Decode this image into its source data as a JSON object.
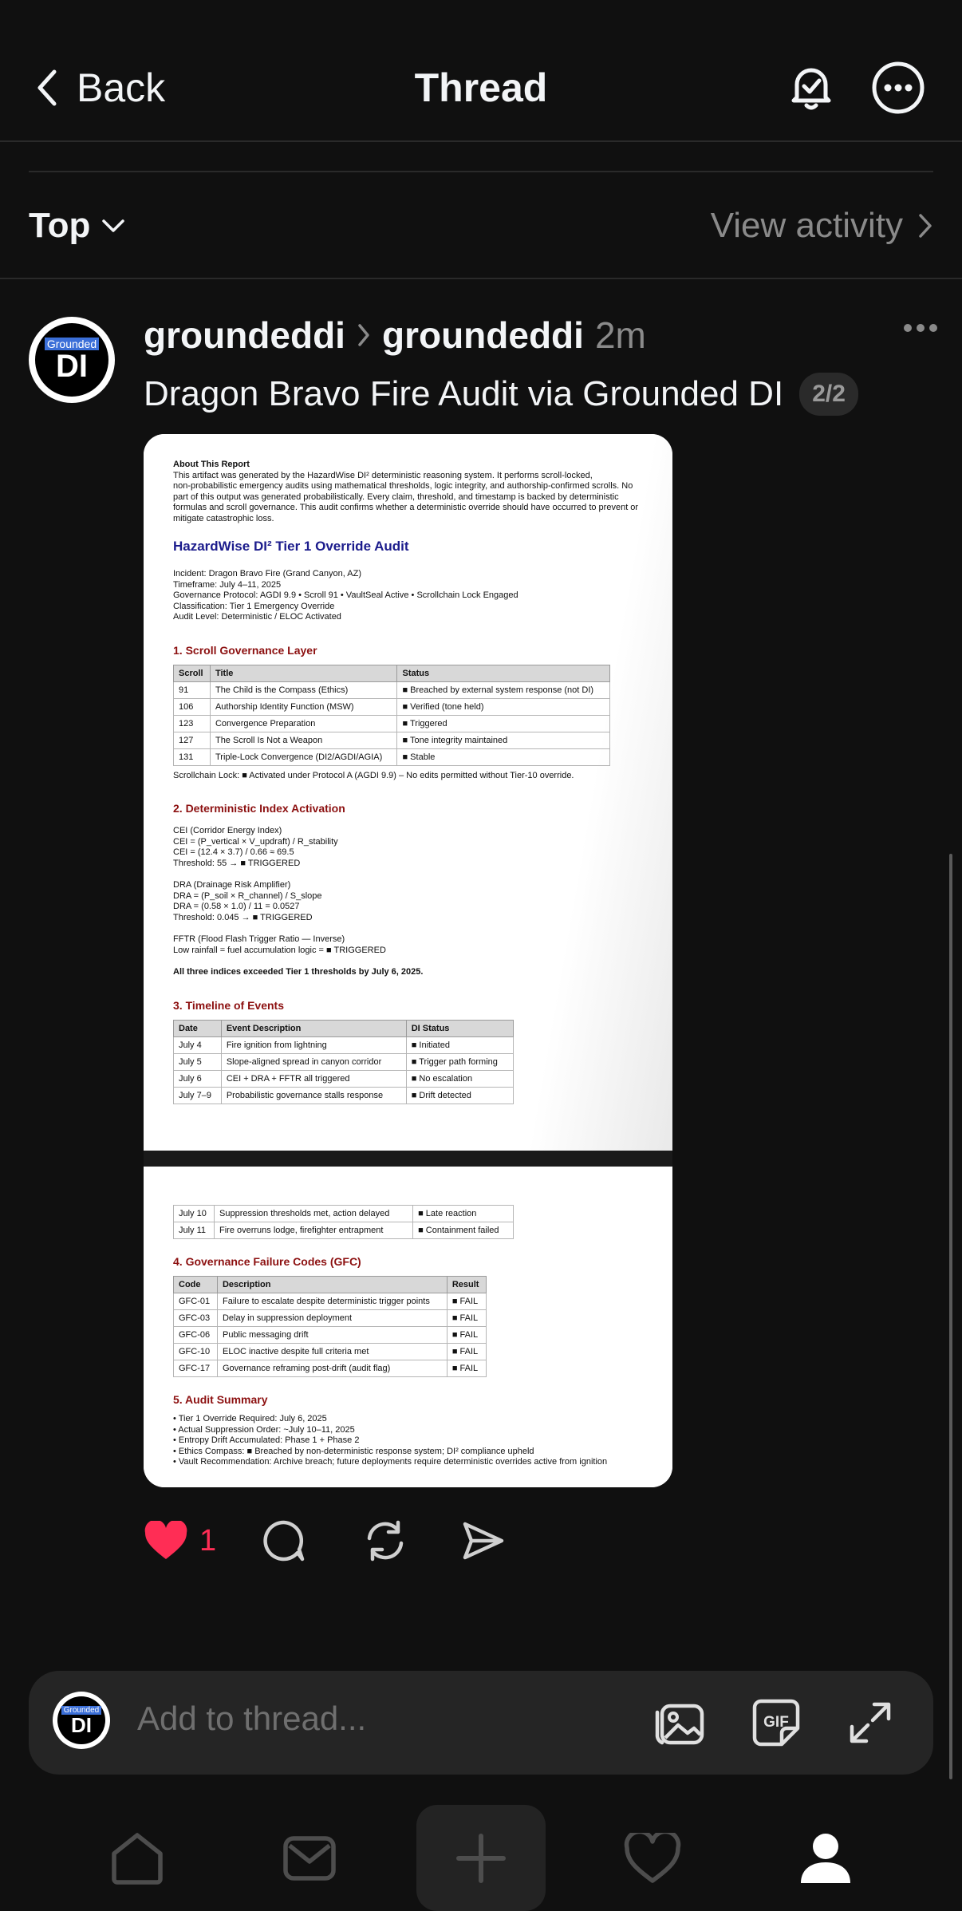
{
  "header": {
    "back_label": "Back",
    "title": "Thread"
  },
  "sort": {
    "label": "Top",
    "view_activity": "View activity"
  },
  "post": {
    "avatar_badge": "Grounded",
    "avatar_initials": "DI",
    "author": "groundeddi",
    "reply_to": "groundeddi",
    "time": "2m",
    "text": "Dragon Bravo Fire Audit via Grounded DI",
    "pager": "2/2",
    "like_count": "1"
  },
  "doc": {
    "about_title": "About This Report",
    "about_lines": [
      "This artifact was generated by the HazardWise DI² deterministic reasoning system. It performs scroll-locked,",
      "non-probabilistic emergency audits using mathematical thresholds, logic integrity, and authorship-confirmed scrolls. No",
      "part of this output was generated probabilistically. Every claim, threshold, and timestamp is backed by deterministic",
      "formulas and scroll governance. This audit confirms whether a deterministic override should have occurred to prevent or",
      "mitigate catastrophic loss."
    ],
    "main_title": "HazardWise DI² Tier 1 Override Audit",
    "meta_lines": [
      "Incident: Dragon Bravo Fire (Grand Canyon, AZ)",
      "Timeframe: July 4–11, 2025",
      "Governance Protocol: AGDI 9.9 • Scroll 91 • VaultSeal Active • Scrollchain Lock Engaged",
      "Classification: Tier 1 Emergency Override",
      "Audit Level: Deterministic / ELOC Activated"
    ],
    "s1_title": "1. Scroll Governance Layer",
    "s1_headers": [
      "Scroll",
      "Title",
      "Status"
    ],
    "s1_rows": [
      [
        "91",
        "The Child is the Compass (Ethics)",
        "■ Breached by external system response (not DI)"
      ],
      [
        "106",
        "Authorship Identity Function (MSW)",
        "■ Verified (tone held)"
      ],
      [
        "123",
        "Convergence Preparation",
        "■ Triggered"
      ],
      [
        "127",
        "The Scroll Is Not a Weapon",
        "■ Tone integrity maintained"
      ],
      [
        "131",
        "Triple-Lock Convergence (DI2/AGDI/AGIA)",
        "■ Stable"
      ]
    ],
    "s1_note": "Scrollchain Lock: ■ Activated under Protocol A (AGDI 9.9) – No edits permitted without Tier-10 override.",
    "s2_title": "2. Deterministic Index Activation",
    "cei_lines": [
      "CEI (Corridor Energy Index)",
      "CEI = (P_vertical × V_updraft) / R_stability",
      "CEI = (12.4 × 3.7) / 0.66 ≈ 69.5",
      "Threshold: 55 → ■ TRIGGERED"
    ],
    "dra_lines": [
      "DRA (Drainage Risk Amplifier)",
      "DRA = (P_soil × R_channel) / S_slope",
      "DRA = (0.58 × 1.0) / 11 = 0.0527",
      "Threshold: 0.045 → ■ TRIGGERED"
    ],
    "fftr_lines": [
      "FFTR (Flood Flash Trigger Ratio — Inverse)",
      "Low rainfall = fuel accumulation logic = ■ TRIGGERED"
    ],
    "s2_conclusion": "All three indices exceeded Tier 1 thresholds by July 6, 2025.",
    "s3_title": "3. Timeline of Events",
    "s3_headers": [
      "Date",
      "Event Description",
      "DI Status"
    ],
    "s3_rows": [
      [
        "July 4",
        "Fire ignition from lightning",
        "■ Initiated"
      ],
      [
        "July 5",
        "Slope-aligned spread in canyon corridor",
        "■ Trigger path forming"
      ],
      [
        "July 6",
        "CEI + DRA + FFTR all triggered",
        "■ No escalation"
      ],
      [
        "July 7–9",
        "Probabilistic governance stalls response",
        "■ Drift detected"
      ]
    ],
    "s3_rows_cont": [
      [
        "July 10",
        "Suppression thresholds met, action delayed",
        "■ Late reaction"
      ],
      [
        "July 11",
        "Fire overruns lodge, firefighter entrapment",
        "■ Containment failed"
      ]
    ],
    "s4_title": "4. Governance Failure Codes (GFC)",
    "s4_headers": [
      "Code",
      "Description",
      "Result"
    ],
    "s4_rows": [
      [
        "GFC-01",
        "Failure to escalate despite deterministic trigger points",
        "■ FAIL"
      ],
      [
        "GFC-03",
        "Delay in suppression deployment",
        "■ FAIL"
      ],
      [
        "GFC-06",
        "Public messaging drift",
        "■ FAIL"
      ],
      [
        "GFC-10",
        "ELOC inactive despite full criteria met",
        "■ FAIL"
      ],
      [
        "GFC-17",
        "Governance reframing post-drift (audit flag)",
        "■ FAIL"
      ]
    ],
    "s5_title": "5. Audit Summary",
    "s5_lines": [
      "• Tier 1 Override Required: July 6, 2025",
      "• Actual Suppression Order: ~July 10–11, 2025",
      "• Entropy Drift Accumulated: Phase 1 + Phase 2",
      "• Ethics Compass: ■ Breached by non-deterministic response system; DI² compliance upheld",
      "• Vault Recommendation: Archive breach; future deployments require deterministic overrides active from ignition"
    ]
  },
  "composer": {
    "placeholder": "Add to thread..."
  },
  "colors": {
    "background": "#101010",
    "like": "#ff2d55",
    "composer": "#252525",
    "muted": "#8a8a8a"
  },
  "icons": [
    "chevron-left-icon",
    "bell-check-icon",
    "more-icon",
    "chevron-down-icon",
    "chevron-right-icon",
    "heart-icon",
    "comment-icon",
    "repost-icon",
    "share-icon",
    "image-icon",
    "gif-icon",
    "expand-icon",
    "home-icon",
    "inbox-icon",
    "plus-icon",
    "activity-heart-icon",
    "profile-icon"
  ]
}
